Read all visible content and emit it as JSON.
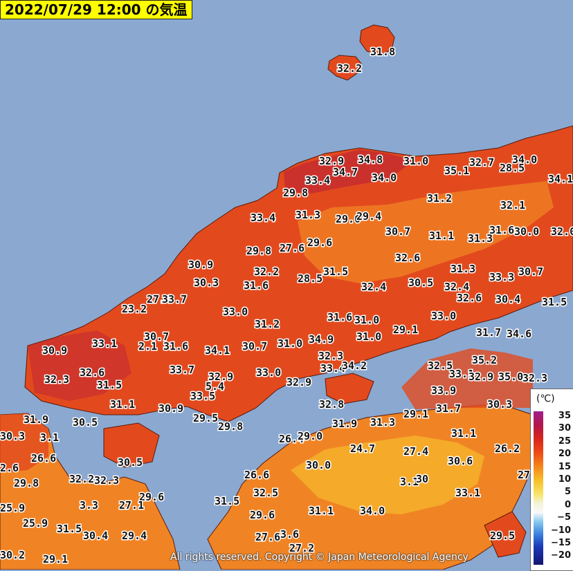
{
  "header": {
    "title": "2022/07/29 12:00 の気温"
  },
  "legend": {
    "unit": "(℃)",
    "ticks": [
      "35",
      "30",
      "25",
      "20",
      "15",
      "10",
      "5",
      "0",
      "−5",
      "−10",
      "−15",
      "−20"
    ]
  },
  "copyright": "All rights reserved. Copyright © Japan Meteorological Agency",
  "colors": {
    "sea": "#8aa8d0",
    "hot_land": "#e24a1e",
    "very_hot_land": "#c42a30",
    "warm_land": "#f08424",
    "mild_land": "#f6b02c",
    "title_background": "#ffff00"
  },
  "temperatures": [
    "31.8",
    "32.2",
    "32.9",
    "34.8",
    "31.0",
    "32.7",
    "34.0",
    "33.4",
    "34.7",
    "34.0",
    "35.1",
    "28.5",
    "34.1",
    "29.8",
    "31.2",
    "32.1",
    "33.4",
    "31.3",
    "29.0",
    "29.4",
    "30.7",
    "31.1",
    "31.3",
    "31.6",
    "30.0",
    "32.0",
    "29.8",
    "27.6",
    "29.6",
    "32.6",
    "30.9",
    "32.2",
    "31.5",
    "31.3",
    "33.3",
    "30.7",
    "30.3",
    "31.6",
    "28.5",
    "32.4",
    "30.5",
    "32.4",
    "32.6",
    "30.4",
    "31.5",
    "23.2",
    "27.4",
    "33.7",
    "33.0",
    "31.2",
    "31.6",
    "31.0",
    "33.0",
    "29.1",
    "31.7",
    "34.6",
    "30.7",
    "33.1",
    "2.1",
    "31.6",
    "34.1",
    "30.7",
    "31.0",
    "34.9",
    "31.0",
    "30.9",
    "32.3",
    "32.6",
    "33.7",
    "32.9",
    "33.0",
    "33.4",
    "34.2",
    "32.5",
    "35.2",
    "32.3",
    "5.4",
    "31.5",
    "32.9",
    "33.1",
    "32.3",
    "32.9",
    "35.0",
    "33.5",
    "33.9",
    "31.1",
    "30.9",
    "32.8",
    "31.7",
    "30.3",
    "31.9",
    "30.5",
    "29.5",
    "29.8",
    "31.9",
    "31.3",
    "29.1",
    "30.3",
    "3.1",
    "26.4",
    "29.0",
    "31.1",
    "24.7",
    "27.4",
    "26.2",
    "2.6",
    "26.6",
    "30.5",
    "30.0",
    "30.6",
    "26.6",
    "32.2",
    "32.3",
    "3.1",
    "30",
    "27.3",
    "29.8",
    "29.6",
    "32.5",
    "33.1",
    "3.3",
    "27.1",
    "25.9",
    "31.5",
    "31.1",
    "34.0",
    "29.6",
    "25.9",
    "31.5",
    "30.4",
    "29.4",
    "27.6",
    "3.6",
    "29.5",
    "30.2",
    "29.1",
    "27.2"
  ]
}
